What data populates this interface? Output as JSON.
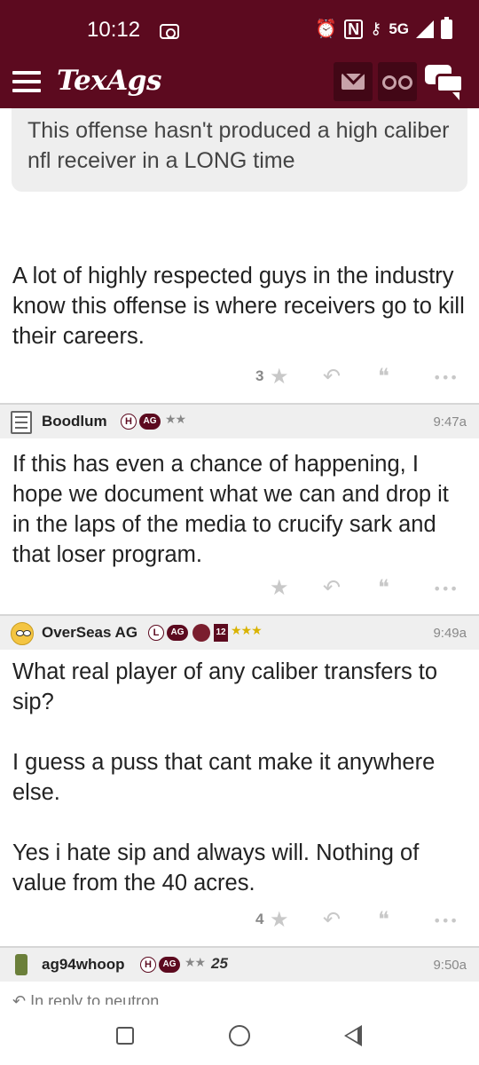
{
  "status_bar": {
    "time": "10:12",
    "network": "5G"
  },
  "app": {
    "logo_text": "TexAgs",
    "colors": {
      "maroon": "#5c0a1f",
      "dark_maroon": "#420716",
      "star_gold": "#d9b300"
    }
  },
  "quoted_post": {
    "text": "This offense hasn't produced a high caliber nfl receiver in a LONG time"
  },
  "posts": [
    {
      "body": [
        "A lot of highly respected guys in the industry know this offense is where receivers go to kill their careers."
      ],
      "star_count": "3"
    },
    {
      "username": "Boodlum",
      "badge_letter": "H",
      "ag_badge": "AG",
      "stars": "★★",
      "time": "9:47a",
      "avatar": "notepad-icon",
      "body": [
        "If this has even a chance of happening, I hope we document what we can and drop it in the laps of the media to crucify sark and that loser program."
      ],
      "star_count": ""
    },
    {
      "username": "OverSeas AG",
      "badge_letter": "L",
      "ag_badge": "AG",
      "extra_badge": "12",
      "stars": "★★★",
      "time": "9:49a",
      "avatar": "rolling-eyes-face-icon",
      "body": [
        "What real player of any caliber transfers to sip?",
        "I guess a puss that cant make it anywhere else.",
        "Yes i hate sip and always will. Nothing of value from the 40 acres."
      ],
      "star_count": "4"
    },
    {
      "username": "ag94whoop",
      "badge_letter": "H",
      "ag_badge": "AG",
      "stars": "★★",
      "extra_text": "25",
      "time": "9:50a",
      "avatar": "phone-icon",
      "reply_peek": "In reply to neutron"
    }
  ],
  "action_icons": {
    "star": "★",
    "reply": "↶",
    "quote": "❝",
    "more": "•••"
  }
}
